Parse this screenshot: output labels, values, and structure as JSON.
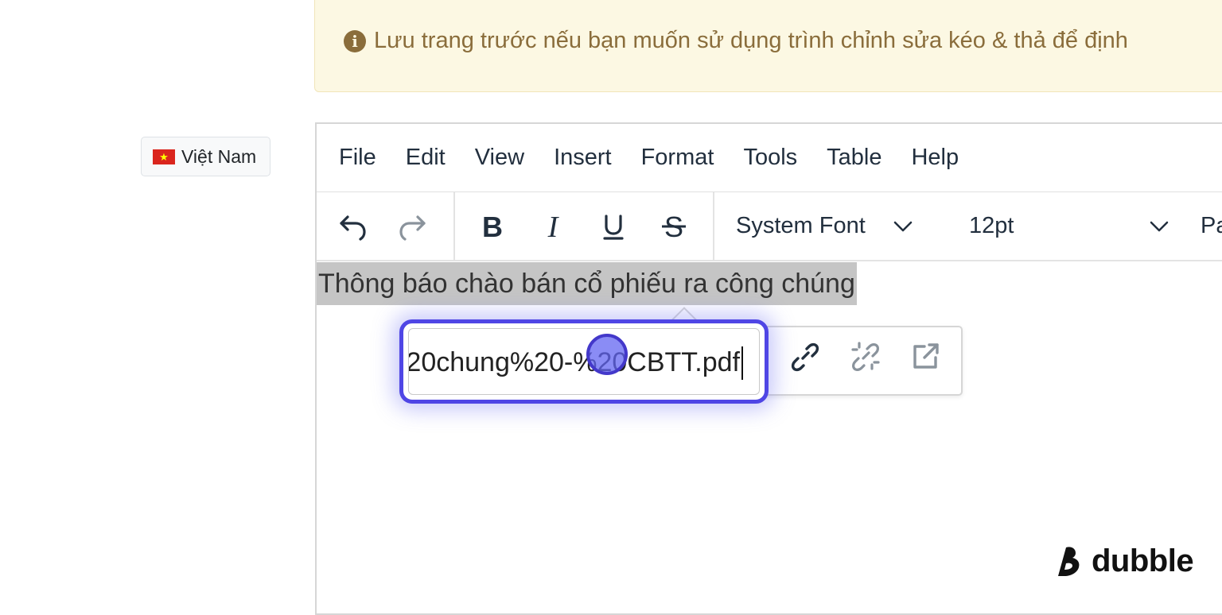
{
  "alert": {
    "text": "Lưu trang trước nếu bạn muốn sử dụng trình chỉnh sửa kéo & thả để định",
    "icon": "info-circle-icon",
    "color": "#8a6d3b",
    "background": "#fcf8e3"
  },
  "language": {
    "label": "Việt Nam",
    "flag_icon": "vietnam-flag-icon"
  },
  "editor": {
    "menu": [
      "File",
      "Edit",
      "View",
      "Insert",
      "Format",
      "Tools",
      "Table",
      "Help"
    ],
    "toolbar": {
      "undo_icon": "undo-icon",
      "redo_icon": "redo-icon",
      "bold_icon": "bold-icon",
      "italic_icon": "italic-icon",
      "underline_icon": "underline-icon",
      "strikethrough_icon": "strikethrough-icon",
      "font_family": "System Font",
      "font_size": "12pt",
      "paragraph_partial": "Pa"
    },
    "content": {
      "selected_text": "Thông báo chào bán cổ phiếu ra công chúng"
    },
    "link_popup": {
      "url_value": "20chung%20-%20CBTT.pdf",
      "link_icon": "link-icon",
      "unlink_icon": "unlink-icon",
      "open_link_icon": "open-link-icon",
      "accent_color": "#4f46e5"
    }
  },
  "watermark": {
    "text": "dubble",
    "icon": "dubble-logo-icon"
  }
}
